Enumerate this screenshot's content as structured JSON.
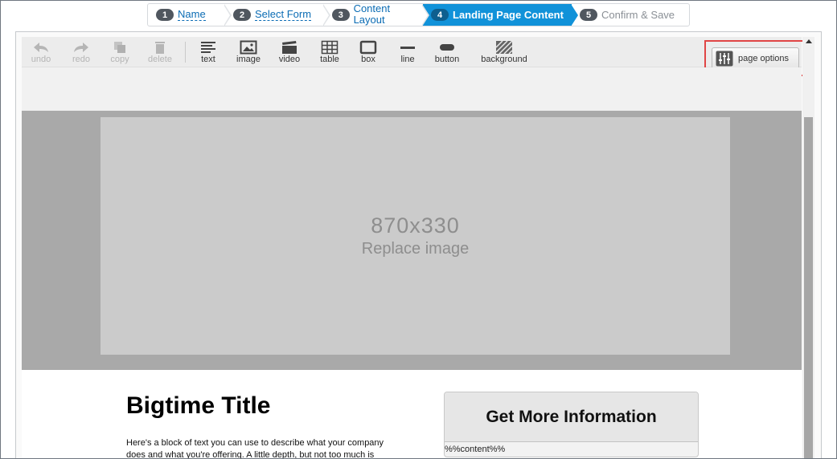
{
  "wizard": {
    "steps": [
      {
        "num": "1",
        "label": "Name"
      },
      {
        "num": "2",
        "label": "Select Form"
      },
      {
        "num": "3",
        "label": "Content Layout"
      },
      {
        "num": "4",
        "label": "Landing Page Content"
      },
      {
        "num": "5",
        "label": "Confirm & Save"
      }
    ],
    "active_step": "4"
  },
  "toolbar": {
    "undo": "undo",
    "redo": "redo",
    "copy": "copy",
    "delete": "delete",
    "text": "text",
    "image": "image",
    "video": "video",
    "table": "table",
    "box": "box",
    "line": "line",
    "button": "button",
    "background": "background",
    "page_options": "page options"
  },
  "canvas": {
    "placeholder_size": "870x330",
    "placeholder_action": "Replace image",
    "title": "Bigtime Title",
    "body": "Here's a block of text you can use to describe what your company does and what you're offering. A little depth, but not too much is",
    "cta_label": "Get More Information",
    "cta_content": "%%content%%"
  },
  "colors": {
    "active_step": "#1192d9",
    "highlight_border": "#e04545",
    "link": "#0b6cb4"
  }
}
